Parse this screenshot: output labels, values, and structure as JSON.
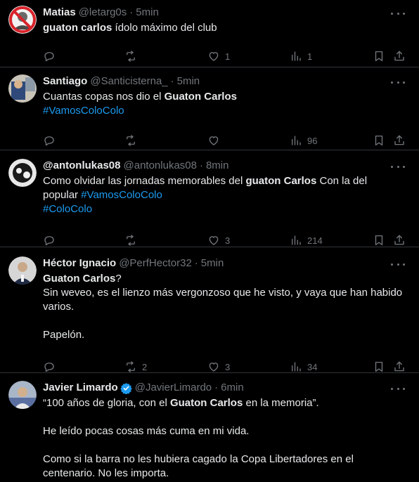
{
  "tweets": [
    {
      "name": "Matias",
      "handle": "@letarg0s",
      "time": "5min",
      "reply_count": "",
      "retweet_count": "",
      "like_count": "1",
      "view_count": "1",
      "text_parts": [
        {
          "bold": "guaton carlos",
          "plain": " ídolo máximo del club"
        }
      ]
    },
    {
      "name": "Santiago",
      "handle": "@Santicisterna_",
      "time": "5min",
      "reply_count": "",
      "retweet_count": "",
      "like_count": "",
      "view_count": "96",
      "line1_plain": "Cuantas copas nos dio el ",
      "line1_bold": "Guaton Carlos",
      "line2_tag": "#VamosColoColo"
    },
    {
      "name": "@antonlukas08",
      "handle": "@antonlukas08",
      "time": "8min",
      "reply_count": "",
      "retweet_count": "",
      "like_count": "3",
      "view_count": "214",
      "line1_plain_a": "Como olvidar las jornadas memorables del ",
      "line1_bold": "guaton Carlos",
      "line1_plain_b": " Con la del",
      "line2_plain": "popular ",
      "line2_tag": "#VamosColoColo",
      "line3_tag": "#ColoColo"
    },
    {
      "name": "Héctor Ignacio",
      "handle": "@PerfHector32",
      "time": "5min",
      "reply_count": "",
      "retweet_count": "2",
      "like_count": "3",
      "view_count": "34",
      "line1_bold": "Guaton Carlos",
      "line1_plain": "?",
      "line2": "Sin weveo, es el lienzo más vergonzoso que he visto, y vaya que han habido",
      "line3": "varios.",
      "line4": "Papelón."
    },
    {
      "name": "Javier Limardo",
      "handle": "@JavierLimardo",
      "time": "6min",
      "line1_plain_a": "“100 años de gloria, con el ",
      "line1_bold": "Guaton Carlos",
      "line1_plain_b": " en la memoria”.",
      "line2": "He leído pocas cosas más cuma en mi vida.",
      "line3": "Como si la barra no les hubiera cagado la Copa Libertadores en el",
      "line4": "centenario. No les importa."
    }
  ],
  "dot": "·",
  "colors": {
    "background": "#000000",
    "text": "#e7e9ea",
    "muted": "#71767b",
    "link": "#1d9bf0",
    "divider": "#2f3336"
  }
}
